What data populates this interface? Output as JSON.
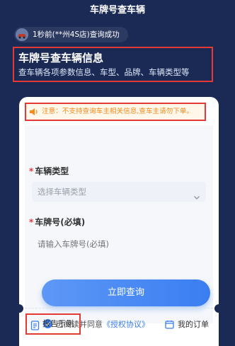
{
  "header": {
    "title": "车牌号查车辆"
  },
  "toast": {
    "text": "1秒前(**州4S店)查询成功"
  },
  "hero": {
    "title": "车牌号查车辆信息",
    "subtitle": "查车辆各项参数信息、车型、品牌、车辆类型等"
  },
  "notice": {
    "text": "注意：不支持查询车主相关信息,查车主请勿下单。"
  },
  "form": {
    "vehicle_type_label": "车辆类型",
    "vehicle_type_value": "选择车辆类型",
    "plate_label": "车牌号(必填)",
    "plate_placeholder": "请输入车牌号(必填)",
    "required_mark": "*"
  },
  "actions": {
    "query_label": "立即查询"
  },
  "agreement": {
    "text": "已阅读并同意",
    "link": "《授权协议》",
    "checked": true
  },
  "footer": {
    "report_label": "报告示例",
    "orders_label": "我的订单"
  },
  "colors": {
    "accent": "#3a7ef2",
    "warning": "#f28b1c",
    "highlight_border": "#e53935",
    "background": "#1b2a55"
  }
}
